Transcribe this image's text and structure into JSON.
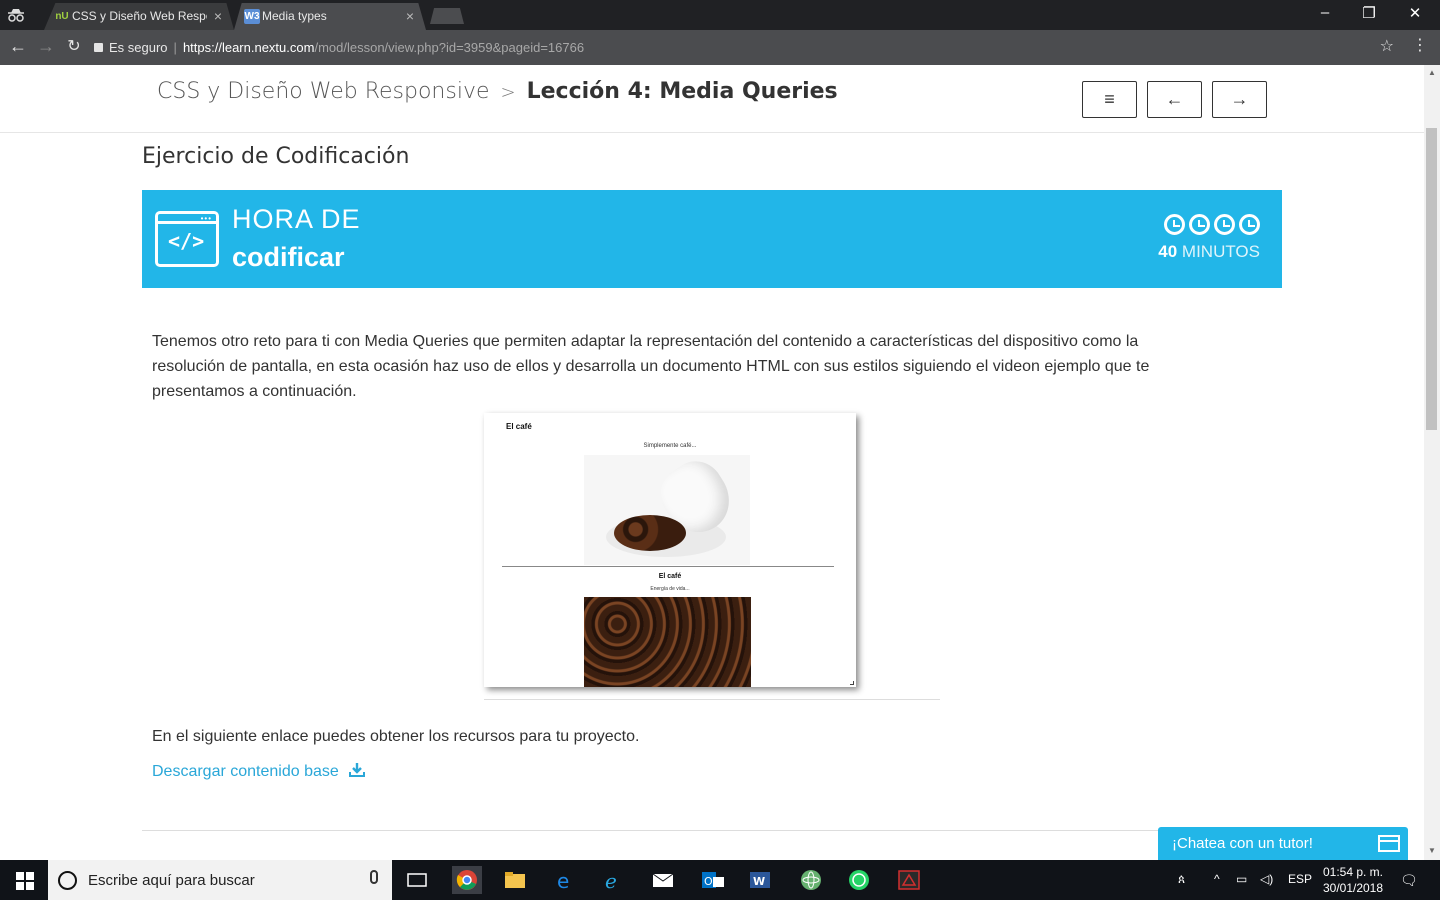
{
  "browser": {
    "tabs": [
      {
        "label": "CSS y Diseño Web Respo",
        "favicon": "nU"
      },
      {
        "label": "Media types",
        "favicon": "W3"
      }
    ],
    "secure_label": "Es seguro",
    "url_host": "https://learn.nextu.com",
    "url_path": "/mod/lesson/view.php?id=3959&pageid=16766"
  },
  "header": {
    "course": "CSS y Diseño Web Responsive",
    "separator": ">",
    "lesson": "Lección 4: Media Queries",
    "menu_glyph": "≡",
    "prev_glyph": "←",
    "next_glyph": "→"
  },
  "page": {
    "title": "Ejercicio de Codificación",
    "banner": {
      "line1": "HORA DE",
      "line2": "codificar",
      "minutes": "40",
      "minutes_label": "MINUTOS",
      "icon": "code-window-icon",
      "color": "#22b6e8"
    },
    "intro": "Tenemos otro reto para ti con Media Queries que permiten adaptar la representación del contenido a características del dispositivo como la resolución de pantalla, en esta ocasión haz uso de ellos y desarrolla un documento HTML con sus estilos siguiendo el videon ejemplo que te presentamos a continuación.",
    "preview": {
      "title": "El café",
      "subtitle": "Simplemente café...",
      "title2": "El café",
      "subtitle2": "Energía de vida..."
    },
    "resources_text": "En el siguiente enlace puedes obtener los recursos para tu proyecto.",
    "download_link": "Descargar contenido base"
  },
  "chat": {
    "label": "¡Chatea con un tutor!"
  },
  "taskbar": {
    "search_placeholder": "Escribe aquí para buscar",
    "language": "ESP",
    "time": "01:54 p. m.",
    "date": "30/01/2018"
  }
}
